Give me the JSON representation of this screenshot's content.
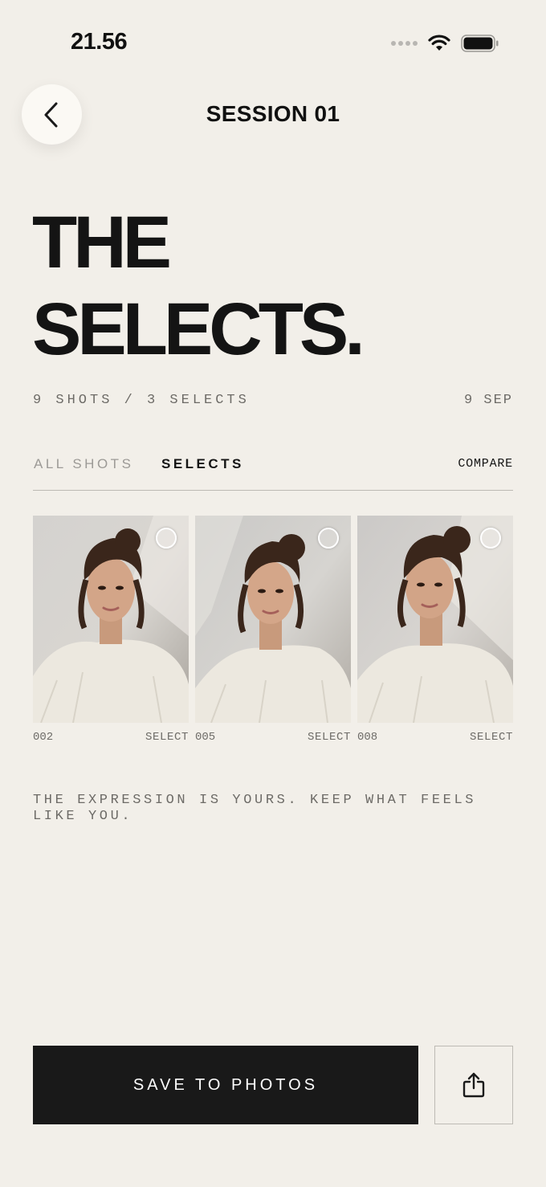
{
  "status_bar": {
    "time": "21.56",
    "icons": [
      "signal-dots-icon",
      "wifi-icon",
      "battery-icon"
    ]
  },
  "nav": {
    "back_icon": "chevron-left-icon",
    "title": "SESSION 01"
  },
  "hero": {
    "line1": "THE",
    "line2": "SELECTS."
  },
  "meta": {
    "count": "9 SHOTS / 3 SELECTS",
    "date": "9 SEP"
  },
  "tabs": {
    "all": "ALL SHOTS",
    "selects": "SELECTS",
    "compare": "COMPARE",
    "active": "SELECTS"
  },
  "photos": [
    {
      "id": "002",
      "action": "SELECT",
      "selected": false
    },
    {
      "id": "005",
      "action": "SELECT",
      "selected": false
    },
    {
      "id": "008",
      "action": "SELECT",
      "selected": false
    }
  ],
  "note": "THE EXPRESSION IS YOURS. KEEP WHAT FEELS LIKE YOU.",
  "actions": {
    "save_label": "SAVE TO PHOTOS",
    "share_icon": "share-icon"
  },
  "colors": {
    "background": "#f2efe9",
    "primary": "#191919",
    "muted": "#6d6b67"
  }
}
